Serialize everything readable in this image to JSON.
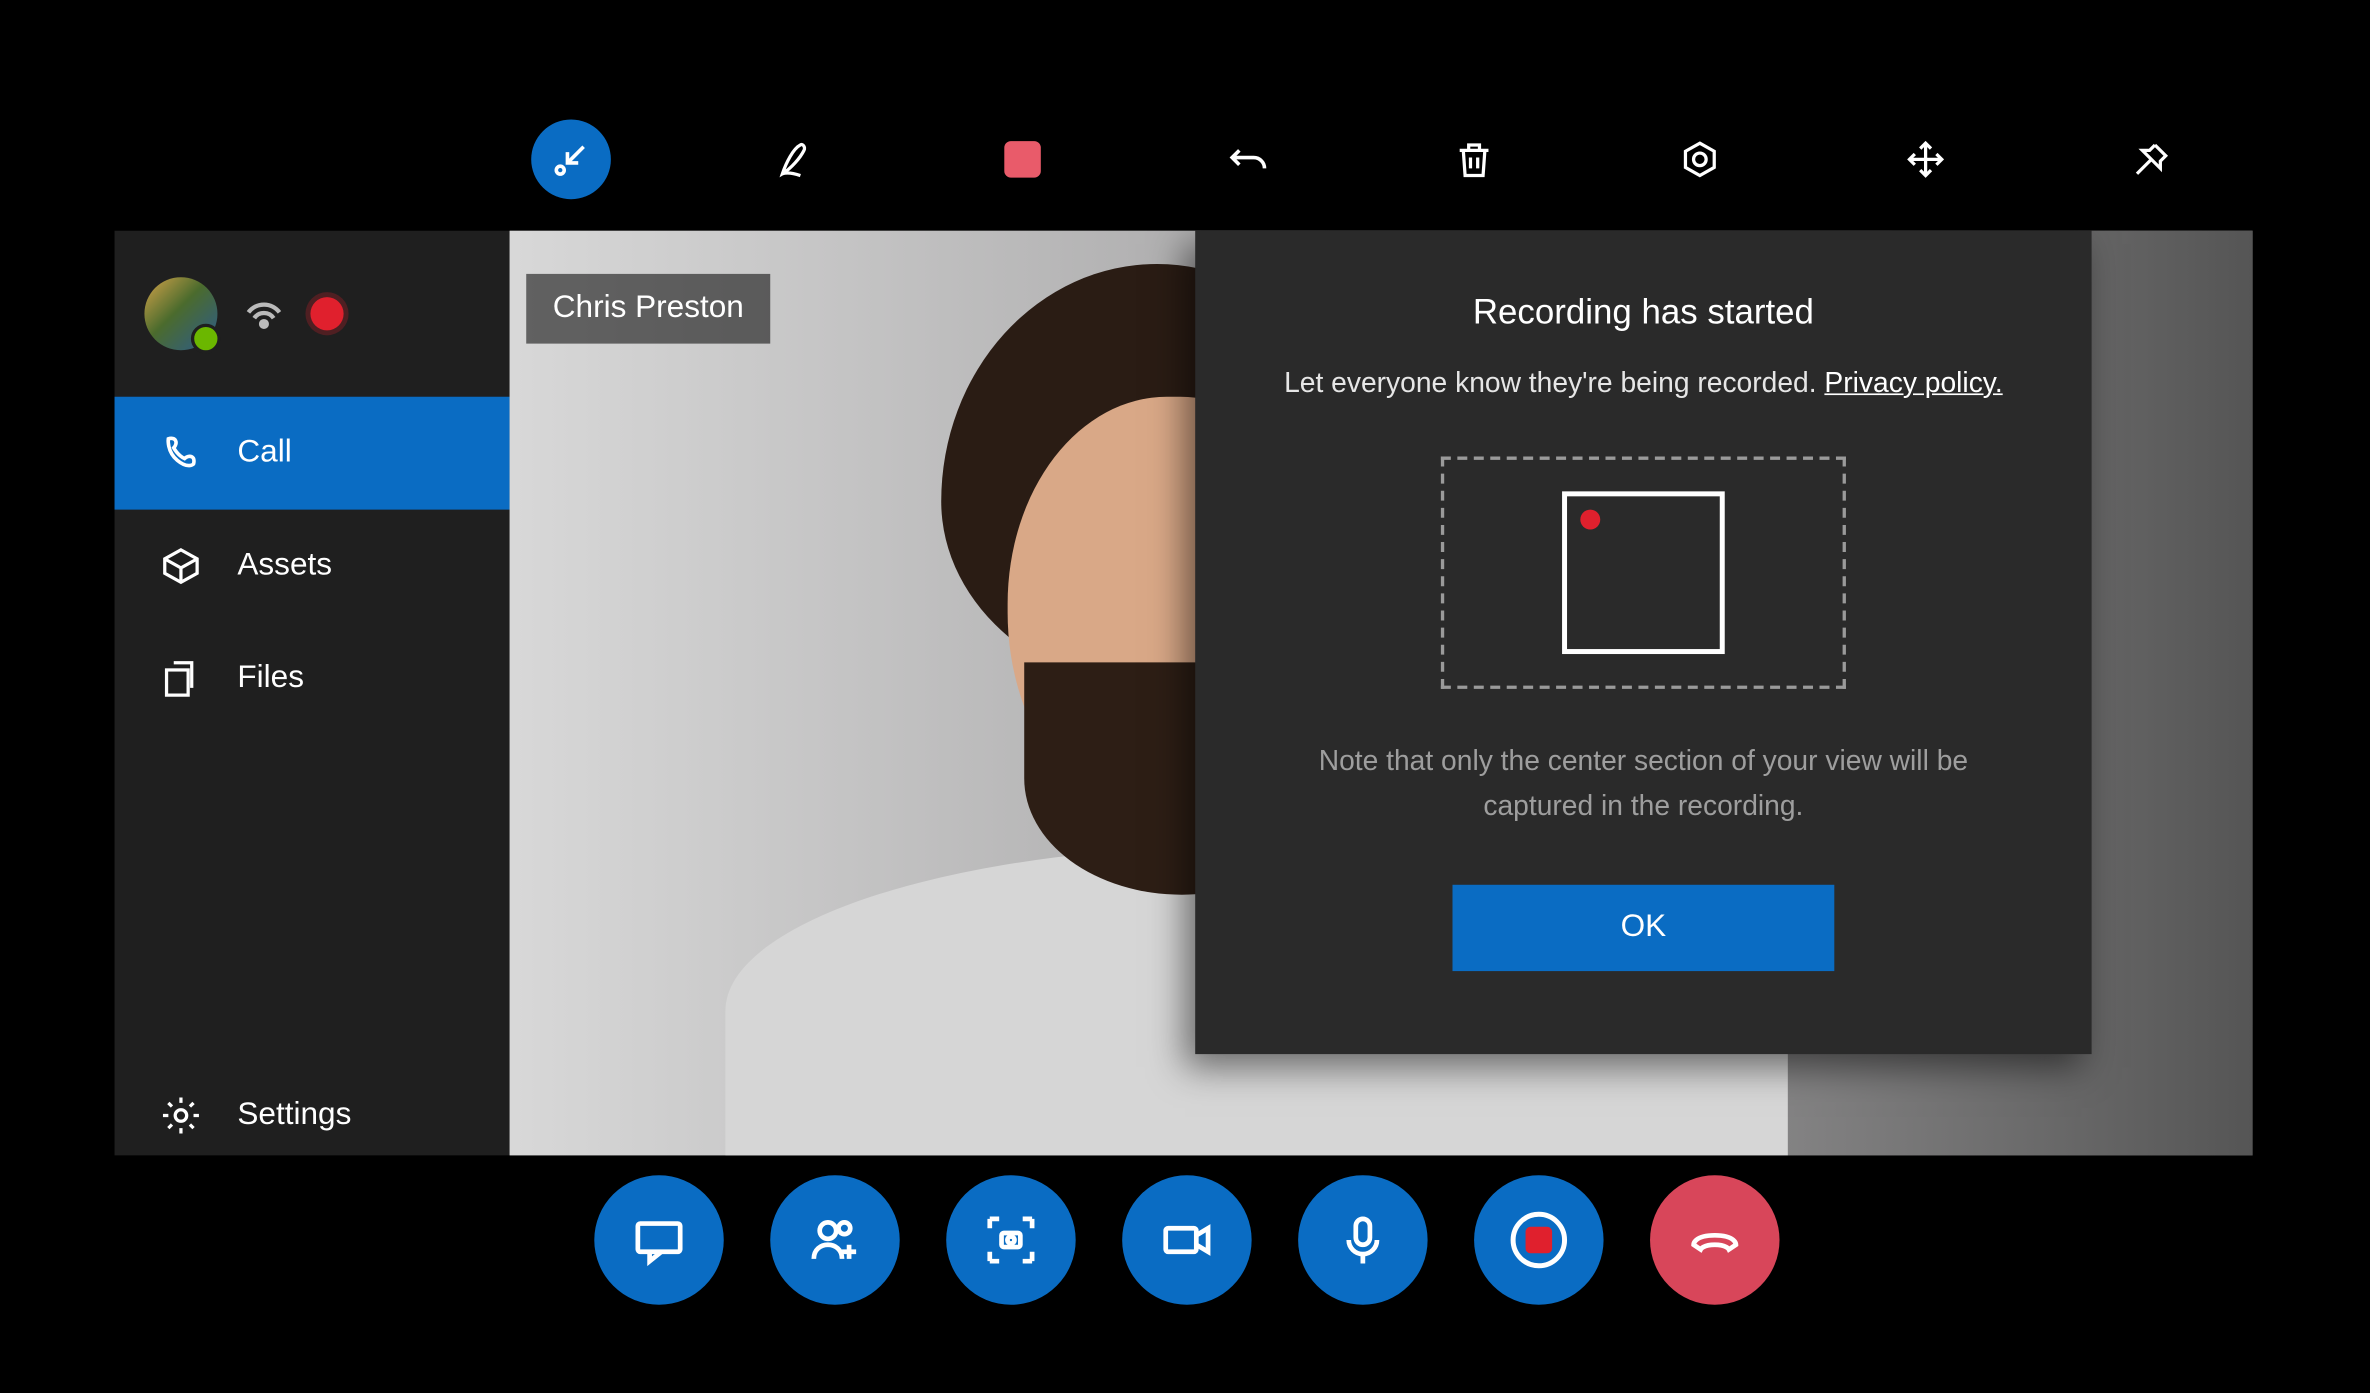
{
  "toolbar": {
    "icons": {
      "collapse": "collapse-arrow-icon",
      "ink": "ink-pen-icon",
      "stop": "stop-recording-icon",
      "undo": "undo-icon",
      "delete": "trash-icon",
      "anchor": "hexagon-location-icon",
      "move": "move-arrows-icon",
      "pin": "pin-icon"
    }
  },
  "sidebar": {
    "status": {
      "presence": "available",
      "connection": "wifi-icon",
      "recording": true
    },
    "items": [
      {
        "icon": "phone-icon",
        "label": "Call",
        "active": true
      },
      {
        "icon": "box-icon",
        "label": "Assets",
        "active": false
      },
      {
        "icon": "files-icon",
        "label": "Files",
        "active": false
      }
    ],
    "settings": {
      "icon": "gear-icon",
      "label": "Settings"
    }
  },
  "video": {
    "participant_name": "Chris Preston"
  },
  "dialog": {
    "title": "Recording has started",
    "subtitle_pre": "Let everyone know they're being recorded. ",
    "privacy_link": "Privacy policy.",
    "note": "Note that only the center section of your view will be captured in the recording.",
    "ok_label": "OK"
  },
  "actions": {
    "chat": "chat-icon",
    "add_people": "add-people-icon",
    "camera": "camera-capture-icon",
    "video": "video-icon",
    "mic": "microphone-icon",
    "record": "record-stop-icon",
    "end": "hangup-icon"
  },
  "colors": {
    "accent": "#0a6cc3",
    "danger": "#d8465a",
    "record_red": "#e0202d",
    "panel": "#1f1f1f",
    "dialog": "#2a2a2a"
  }
}
